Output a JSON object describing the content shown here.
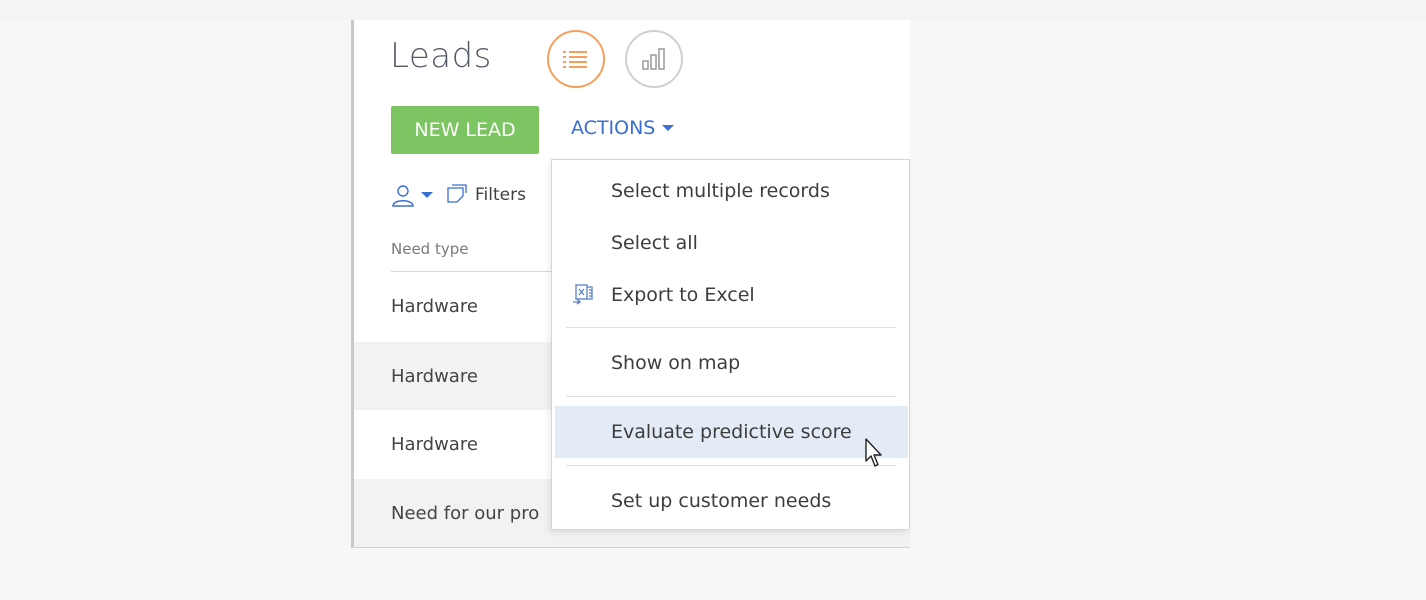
{
  "page": {
    "title": "Leads",
    "view_list_icon": "list-view-icon",
    "view_chart_icon": "analytics-view-icon"
  },
  "toolbar": {
    "new_lead_label": "NEW LEAD",
    "actions_label": "ACTIONS",
    "filters_label": "Filters"
  },
  "table": {
    "column_header": "Need type",
    "rows": [
      "Hardware",
      "Hardware",
      "Hardware",
      "Need for our pro"
    ]
  },
  "actions_menu": {
    "items": [
      {
        "label": "Select multiple records"
      },
      {
        "label": "Select all"
      },
      {
        "label": "Export to Excel",
        "icon": "excel-export-icon"
      },
      {
        "label": "Show on map"
      },
      {
        "label": "Evaluate predictive score",
        "hovered": true
      },
      {
        "label": "Set up customer needs"
      }
    ]
  },
  "colors": {
    "accent_orange": "#f5a05a",
    "new_lead_green": "#7cc562",
    "link_blue": "#3b6ed1",
    "hover_bg": "#e3ebf7"
  }
}
